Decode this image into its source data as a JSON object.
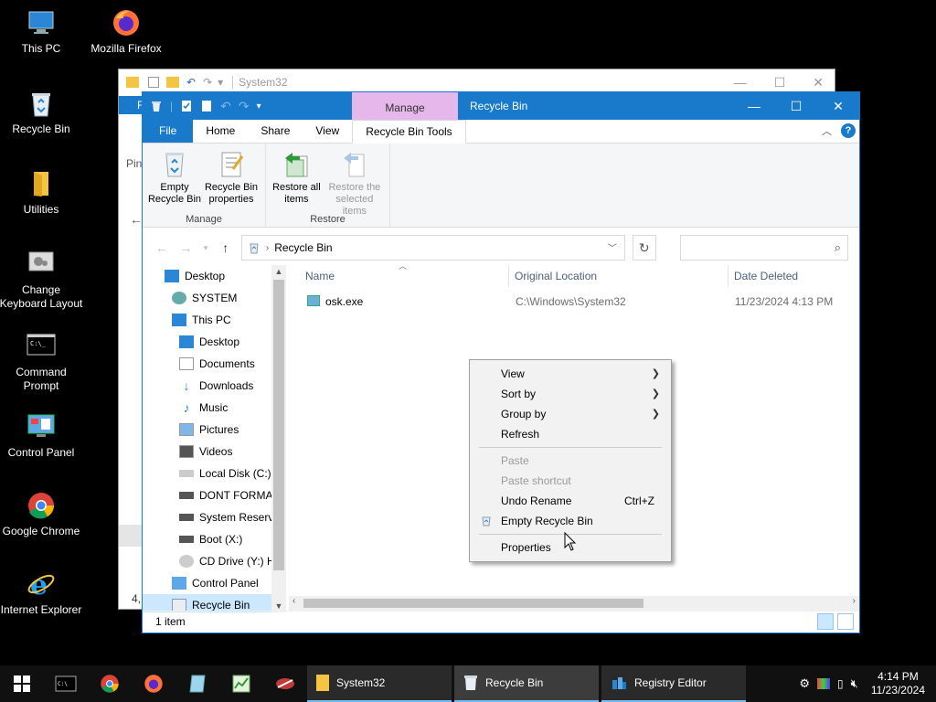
{
  "desktop": {
    "icons": [
      {
        "label": "This PC"
      },
      {
        "label": "Mozilla Firefox"
      },
      {
        "label": "Recycle Bin"
      },
      {
        "label": "Utilities"
      },
      {
        "label": "Change Keyboard Layout"
      },
      {
        "label": "Command Prompt"
      },
      {
        "label": "Control Panel"
      },
      {
        "label": "Google Chrome"
      },
      {
        "label": "Internet Explorer"
      }
    ]
  },
  "bg_window": {
    "title": "System32",
    "ribbon_file": "F",
    "pin_text": "Pin",
    "status_partial": "4,"
  },
  "window": {
    "title": "Recycle Bin",
    "context_tab": "Manage",
    "tabs": [
      "File",
      "Home",
      "Share",
      "View",
      "Recycle Bin Tools"
    ],
    "ribbon": {
      "manage_group": "Manage",
      "restore_group": "Restore",
      "empty_bin": "Empty Recycle Bin",
      "properties": "Recycle Bin properties",
      "restore_all": "Restore all items",
      "restore_selected": "Restore the selected items"
    },
    "address": {
      "crumb": "Recycle Bin",
      "search_placeholder": ""
    },
    "nav": [
      {
        "label": "Desktop",
        "indent": 0
      },
      {
        "label": "SYSTEM",
        "indent": 1
      },
      {
        "label": "This PC",
        "indent": 1
      },
      {
        "label": "Desktop",
        "indent": 2
      },
      {
        "label": "Documents",
        "indent": 2
      },
      {
        "label": "Downloads",
        "indent": 2
      },
      {
        "label": "Music",
        "indent": 2
      },
      {
        "label": "Pictures",
        "indent": 2
      },
      {
        "label": "Videos",
        "indent": 2
      },
      {
        "label": "Local Disk (C:)",
        "indent": 2
      },
      {
        "label": "DONT FORMAT",
        "indent": 2
      },
      {
        "label": "System Reserve",
        "indent": 2
      },
      {
        "label": "Boot (X:)",
        "indent": 2
      },
      {
        "label": "CD Drive (Y:) H",
        "indent": 2
      },
      {
        "label": "Control Panel",
        "indent": 1
      },
      {
        "label": "Recycle Bin",
        "indent": 1
      }
    ],
    "columns": [
      "Name",
      "Original Location",
      "Date Deleted"
    ],
    "files": [
      {
        "name": "osk.exe",
        "location": "C:\\Windows\\System32",
        "date": "11/23/2024 4:13 PM"
      }
    ],
    "status": "1 item"
  },
  "context_menu": {
    "items": [
      {
        "label": "View",
        "submenu": true,
        "disabled": false
      },
      {
        "label": "Sort by",
        "submenu": true,
        "disabled": false
      },
      {
        "label": "Group by",
        "submenu": true,
        "disabled": false
      },
      {
        "label": "Refresh",
        "submenu": false,
        "disabled": false
      },
      {
        "label": "Paste",
        "submenu": false,
        "disabled": true
      },
      {
        "label": "Paste shortcut",
        "submenu": false,
        "disabled": true
      },
      {
        "label": "Undo Rename",
        "shortcut": "Ctrl+Z",
        "disabled": false
      },
      {
        "label": "Empty Recycle Bin",
        "disabled": false
      },
      {
        "label": "Properties",
        "disabled": false
      }
    ]
  },
  "taskbar": {
    "apps": [
      {
        "label": "System32",
        "icon": "folder-icon"
      },
      {
        "label": "Recycle Bin",
        "icon": "recycle-bin-icon"
      },
      {
        "label": "Registry Editor",
        "icon": "registry-editor-icon"
      }
    ],
    "clock_time": "4:14 PM",
    "clock_date": "11/23/2024"
  },
  "colors": {
    "accent": "#1979ca",
    "manage_tab": "#e6b7ea",
    "desktop_bg": "#000000",
    "taskbar_bg": "#101010"
  }
}
